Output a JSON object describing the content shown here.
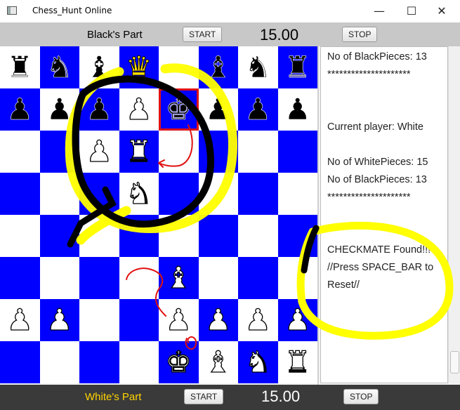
{
  "window": {
    "title": "Chess_Hunt Online",
    "icon": "window-icon"
  },
  "controls": {
    "minimize": "—",
    "maximize": "☐",
    "close": "✕"
  },
  "top_bar": {
    "label": "Black's Part",
    "start": "START",
    "timer": "15.00",
    "stop": "STOP"
  },
  "bottom_bar": {
    "label": "White's Part",
    "start": "START",
    "timer": "15.00",
    "stop": "STOP"
  },
  "colors": {
    "light_square": "#ffffff",
    "dark_square": "#0000ff",
    "selected_outline": "#e01010",
    "highlighter": "#ffff00",
    "annotation_ink": "#000000",
    "annotation_red": "#e01010"
  },
  "board": {
    "rows": [
      [
        "br",
        "bn",
        "bb",
        "bq",
        "",
        "bb",
        "bn",
        "br"
      ],
      [
        "bp",
        "bp",
        "bp",
        "wp",
        "bk",
        "bp",
        "bp",
        "bp"
      ],
      [
        "",
        "",
        "wp",
        "wr",
        "",
        "",
        "",
        ""
      ],
      [
        "",
        "",
        "",
        "wn",
        "",
        "",
        "",
        ""
      ],
      [
        "",
        "",
        "",
        "",
        "",
        "",
        "",
        ""
      ],
      [
        "",
        "",
        "",
        "",
        "wb",
        "",
        "",
        ""
      ],
      [
        "wp",
        "wp",
        "",
        "",
        "wp",
        "wp",
        "wp",
        "wp"
      ],
      [
        "",
        "",
        "",
        "",
        "wk",
        "wb",
        "wn",
        "wr"
      ]
    ],
    "selected": "bk-e7",
    "highlighted": "bq-d8"
  },
  "glyphs": {
    "k": "♚",
    "q": "♛",
    "r": "♜",
    "b": "♝",
    "n": "♞",
    "p": "♟"
  },
  "console": {
    "lines": [
      "No of BlackPieces: 13",
      "*********************",
      "",
      "",
      "Current player: White",
      "",
      "No of WhitePieces: 15",
      "No of BlackPieces: 13",
      "*********************",
      "",
      "",
      "CHECKMATE Found!!!",
      "//Press SPACE_BAR to",
      "Reset//"
    ]
  }
}
